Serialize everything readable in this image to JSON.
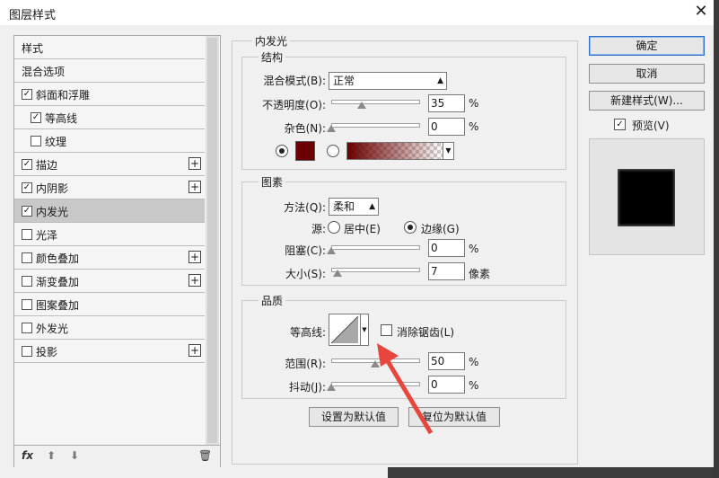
{
  "window": {
    "title": "图层样式",
    "close": "✕"
  },
  "left_list": {
    "items": [
      {
        "label": "样式",
        "checkbox": false,
        "checked": false,
        "plus": false,
        "selected": false
      },
      {
        "label": "混合选项",
        "checkbox": false,
        "checked": false,
        "plus": false,
        "selected": false
      },
      {
        "label": "斜面和浮雕",
        "checkbox": true,
        "checked": true,
        "plus": false,
        "selected": false
      },
      {
        "label": "等高线",
        "checkbox": true,
        "checked": true,
        "plus": false,
        "selected": false,
        "indent": true
      },
      {
        "label": "纹理",
        "checkbox": true,
        "checked": false,
        "plus": false,
        "selected": false,
        "indent": true
      },
      {
        "label": "描边",
        "checkbox": true,
        "checked": true,
        "plus": true,
        "selected": false
      },
      {
        "label": "内阴影",
        "checkbox": true,
        "checked": true,
        "plus": true,
        "selected": false
      },
      {
        "label": "内发光",
        "checkbox": true,
        "checked": true,
        "plus": false,
        "selected": true
      },
      {
        "label": "光泽",
        "checkbox": true,
        "checked": false,
        "plus": false,
        "selected": false
      },
      {
        "label": "颜色叠加",
        "checkbox": true,
        "checked": false,
        "plus": true,
        "selected": false
      },
      {
        "label": "渐变叠加",
        "checkbox": true,
        "checked": false,
        "plus": true,
        "selected": false
      },
      {
        "label": "图案叠加",
        "checkbox": true,
        "checked": false,
        "plus": false,
        "selected": false
      },
      {
        "label": "外发光",
        "checkbox": true,
        "checked": false,
        "plus": false,
        "selected": false
      },
      {
        "label": "投影",
        "checkbox": true,
        "checked": false,
        "plus": true,
        "selected": false
      }
    ],
    "footer": {
      "fx": "fx",
      "up": "⬆",
      "down": "⬇",
      "trash": "🗑"
    }
  },
  "panel": {
    "title": "内发光",
    "structure": {
      "title": "结构",
      "blend_mode_label": "混合模式(B):",
      "blend_mode_value": "正常",
      "opacity_label": "不透明度(O):",
      "opacity_value": "35",
      "opacity_unit": "%",
      "noise_label": "杂色(N):",
      "noise_value": "0",
      "noise_unit": "%",
      "color_swatch": "#6b0000",
      "gradient_start": "#6b0000",
      "opacity_level": 0.35,
      "noise_level": 0.0
    },
    "elements": {
      "title": "图素",
      "method_label": "方法(Q):",
      "method_value": "柔和",
      "source_label": "源:",
      "source_center": "居中(E)",
      "source_edge": "边缘(G)",
      "choke_label": "阻塞(C):",
      "choke_value": "0",
      "choke_unit": "%",
      "size_label": "大小(S):",
      "size_value": "7",
      "size_unit": "像素",
      "choke_level": 0.0,
      "size_level": 0.07
    },
    "quality": {
      "title": "品质",
      "contour_label": "等高线:",
      "antialias_label": "消除锯齿(L)",
      "range_label": "范围(R):",
      "range_value": "50",
      "range_unit": "%",
      "jitter_label": "抖动(J):",
      "jitter_value": "0",
      "jitter_unit": "%",
      "range_level": 0.5,
      "jitter_level": 0.0
    },
    "set_default": "设置为默认值",
    "reset_default": "复位为默认值"
  },
  "right": {
    "ok": "确定",
    "cancel": "取消",
    "new_style": "新建样式(W)...",
    "preview_label": "预览(V)",
    "preview_checked": true
  },
  "annotation": {
    "arrow_color": "#e8453c"
  }
}
